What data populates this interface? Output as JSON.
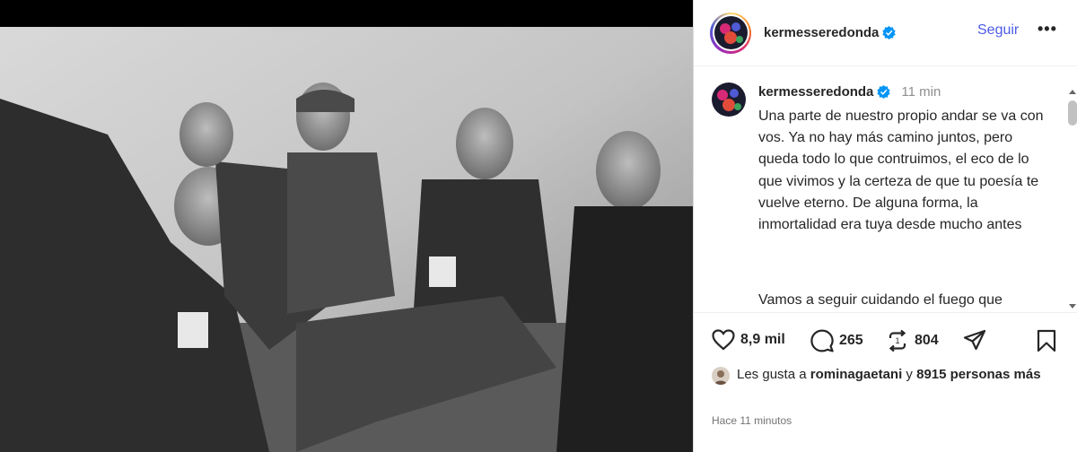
{
  "post": {
    "username": "kermesseredonda",
    "follow_label": "Seguir",
    "more_label": "•••",
    "time_ago": "11 min",
    "caption_paragraph_1": "Una parte de nuestro propio andar se va con vos. Ya no hay más camino juntos, pero queda todo lo que contruimos, el eco de lo que vivimos y la certeza de que tu poesía te vuelve eterno. De alguna forma, la inmortalidad era tuya desde mucho antes",
    "caption_paragraph_2": "Vamos a seguir cuidando el fuego que",
    "likes_count": "8,9 mil",
    "comments_count": "265",
    "reposts_count": "804",
    "liked_by_prefix": "Les gusta a ",
    "liked_by_user": "rominagaetani",
    "liked_by_middle": " y ",
    "liked_by_others": "8915 personas más",
    "timestamp": "Hace 11 minutos"
  },
  "icons": {
    "verified": "verified-badge-icon",
    "like": "heart-icon",
    "comment": "comment-bubble-icon",
    "repost": "repost-icon",
    "share": "paper-plane-icon",
    "save": "bookmark-icon"
  },
  "colors": {
    "accent_link": "#4d5ce6",
    "verified_blue": "#0095f6",
    "text": "#262626",
    "muted": "#8e8e8e"
  }
}
